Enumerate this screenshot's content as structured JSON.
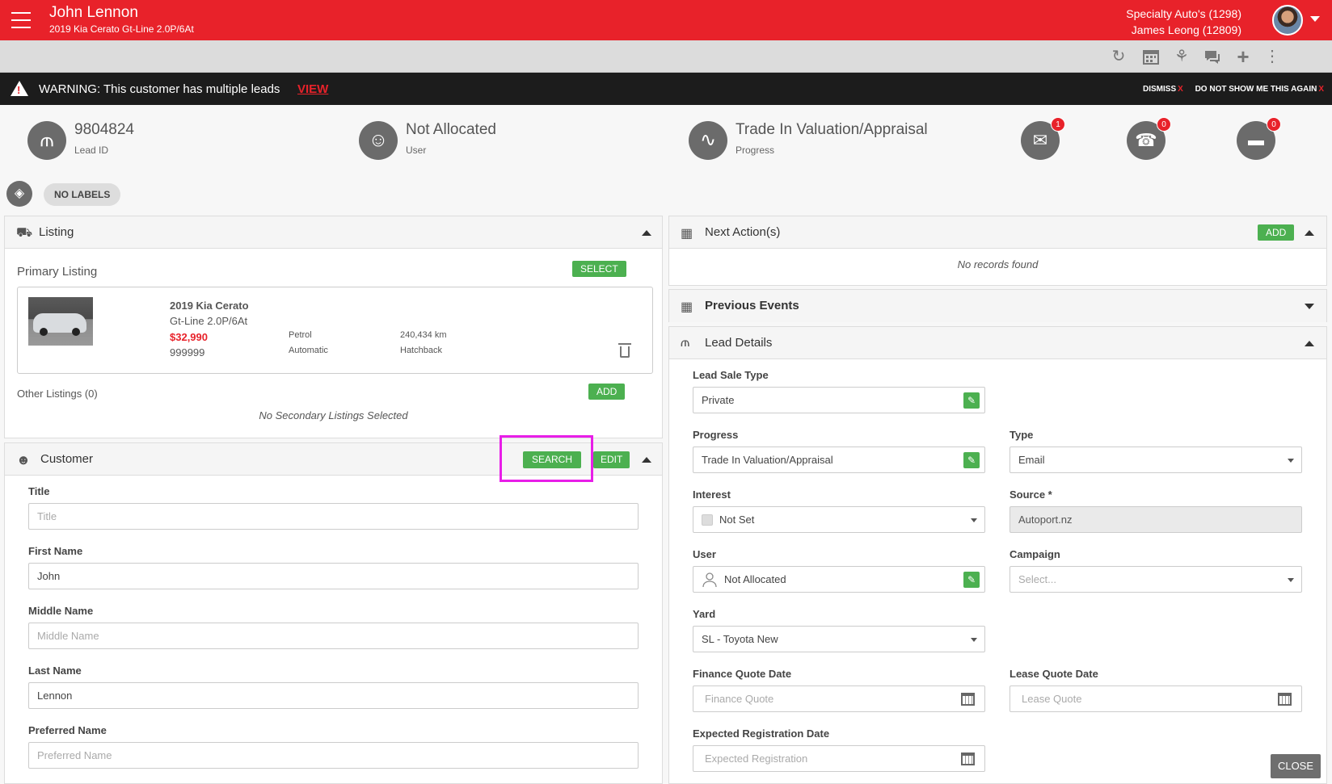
{
  "header": {
    "title": "John Lennon",
    "subtitle": "2019 Kia Cerato Gt-Line 2.0P/6At",
    "dealer": "Specialty Auto's (1298)",
    "user": "James Leong (12809)"
  },
  "toolbar": {
    "icons": [
      "refresh-icon",
      "calendar-icon",
      "handshake-icon",
      "chat-icon",
      "plus-icon",
      "more-vertical-icon"
    ]
  },
  "warning": {
    "text": "WARNING: This customer has multiple leads",
    "view": "VIEW",
    "dismiss": "DISMISS",
    "dont_show": "DO NOT SHOW ME THIS AGAIN",
    "x": "X"
  },
  "stats": {
    "lead_id": "9804824",
    "lead_id_label": "Lead ID",
    "user": "Not Allocated",
    "user_label": "User",
    "progress": "Trade In Valuation/Appraisal",
    "progress_label": "Progress",
    "email_count": "1",
    "phone_count": "0",
    "sms_count": "0"
  },
  "labels": {
    "no_labels": "NO LABELS"
  },
  "listing": {
    "title": "Listing",
    "primary_title": "Primary Listing",
    "select": "SELECT",
    "car_name": "2019 Kia Cerato",
    "car_variant": "Gt-Line 2.0P/6At",
    "price": "$32,990",
    "stock": "999999",
    "fuel": "Petrol",
    "transmission": "Automatic",
    "odometer": "240,434 km",
    "body": "Hatchback",
    "other_title": "Other Listings (0)",
    "add": "ADD",
    "no_secondary": "No Secondary Listings Selected"
  },
  "customer": {
    "title": "Customer",
    "search": "SEARCH",
    "edit": "EDIT",
    "fields": {
      "title_label": "Title",
      "title_placeholder": "Title",
      "first_label": "First Name",
      "first_value": "John",
      "middle_label": "Middle Name",
      "middle_placeholder": "Middle Name",
      "last_label": "Last Name",
      "last_value": "Lennon",
      "preferred_label": "Preferred Name",
      "preferred_placeholder": "Preferred Name"
    }
  },
  "next_actions": {
    "title": "Next Action(s)",
    "add": "ADD",
    "empty": "No records found"
  },
  "previous_events": {
    "title": "Previous Events"
  },
  "lead_details": {
    "title": "Lead Details",
    "sale_type_label": "Lead Sale Type",
    "sale_type_value": "Private",
    "progress_label": "Progress",
    "progress_value": "Trade In Valuation/Appraisal",
    "type_label": "Type",
    "type_value": "Email",
    "interest_label": "Interest",
    "interest_value": "Not Set",
    "source_label": "Source *",
    "source_value": "Autoport.nz",
    "user_label": "User",
    "user_value": "Not Allocated",
    "campaign_label": "Campaign",
    "campaign_placeholder": "Select...",
    "yard_label": "Yard",
    "yard_value": "SL - Toyota New",
    "finance_label": "Finance Quote Date",
    "finance_placeholder": "Finance Quote",
    "lease_label": "Lease Quote Date",
    "lease_placeholder": "Lease Quote",
    "expected_label": "Expected Registration Date",
    "expected_placeholder": "Expected Registration"
  },
  "footer": {
    "close": "CLOSE"
  },
  "colors": {
    "brand_red": "#e8222a",
    "green": "#4cb050",
    "highlight": "#e81ee8"
  }
}
